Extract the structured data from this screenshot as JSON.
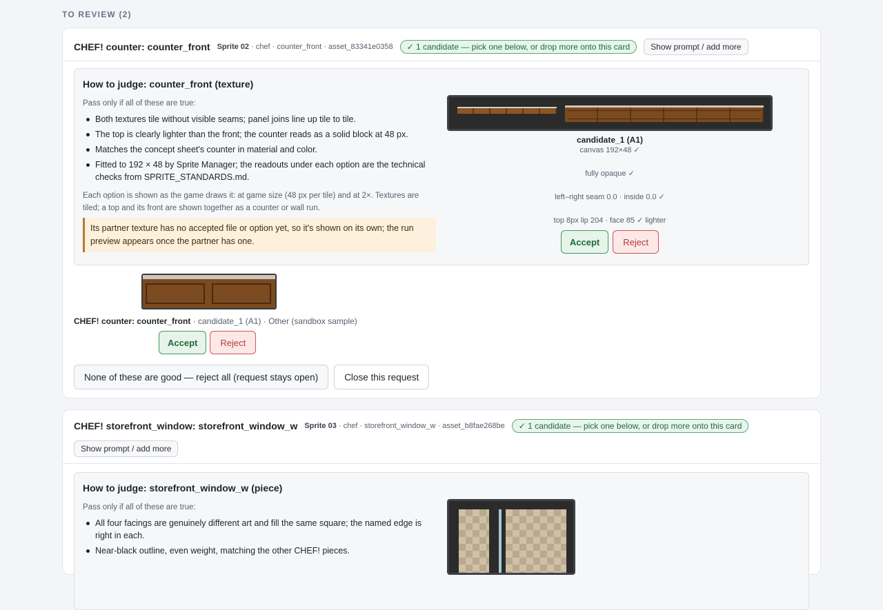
{
  "section": {
    "title": "TO REVIEW (2)"
  },
  "cards": [
    {
      "title": "CHEF! counter: counter_front",
      "meta_sprite": "Sprite 02",
      "meta_rest": "· chef · counter_front · asset_83341e0358",
      "status": "✓ 1 candidate — pick one below, or drop more onto this card",
      "prompt_btn": "Show prompt / add more",
      "judge": {
        "title": "How to judge: counter_front (texture)",
        "pass_label": "Pass only if all of these are true:",
        "criteria": [
          "Both textures tile without visible seams; panel joins line up tile to tile.",
          "The top is clearly lighter than the front; the counter reads as a solid block at 48 px.",
          "Matches the concept sheet's counter in material and color.",
          "Fitted to 192 × 48 by Sprite Manager; the readouts under each option are the technical checks from SPRITE_STANDARDS.md."
        ],
        "note": "Each option is shown as the game draws it: at game size (48 px per tile) and at 2×. Textures are tiled; a top and its front are shown together as a counter or wall run.",
        "warning": "Its partner texture has no accepted file or option yet, so it's shown on its own; the run preview appears once the partner has one.",
        "candidate": {
          "name": "candidate_1 (A1)",
          "checks": [
            "canvas 192×48 ✓",
            "fully opaque ✓",
            "left–right seam 0.0 · inside 0.0 ✓",
            "top 8px lip 204 · face 85 ✓ lighter"
          ],
          "accept": "Accept",
          "reject": "Reject"
        }
      },
      "sample": {
        "title": "CHEF! counter: counter_front",
        "caption": " · candidate_1 (A1) · Other (sandbox sample)",
        "accept": "Accept",
        "reject": "Reject"
      },
      "reject_all": "None of these are good — reject all (request stays open)",
      "close": "Close this request"
    },
    {
      "title": "CHEF! storefront_window: storefront_window_w",
      "meta_sprite": "Sprite 03",
      "meta_rest": "· chef · storefront_window_w · asset_b8fae268be",
      "status": "✓ 1 candidate — pick one below, or drop more onto this card",
      "prompt_btn": "Show prompt / add more",
      "judge": {
        "title": "How to judge: storefront_window_w (piece)",
        "pass_label": "Pass only if all of these are true:",
        "criteria": [
          "All four facings are genuinely different art and fill the same square; the named edge is right in each.",
          "Near-black outline, even weight, matching the other CHEF! pieces."
        ]
      }
    }
  ],
  "colors": {
    "accept": "#1d6b3a",
    "reject": "#b33a3a",
    "status_pill": "#e8f5ec",
    "warning_bg": "#fdf0dc"
  }
}
